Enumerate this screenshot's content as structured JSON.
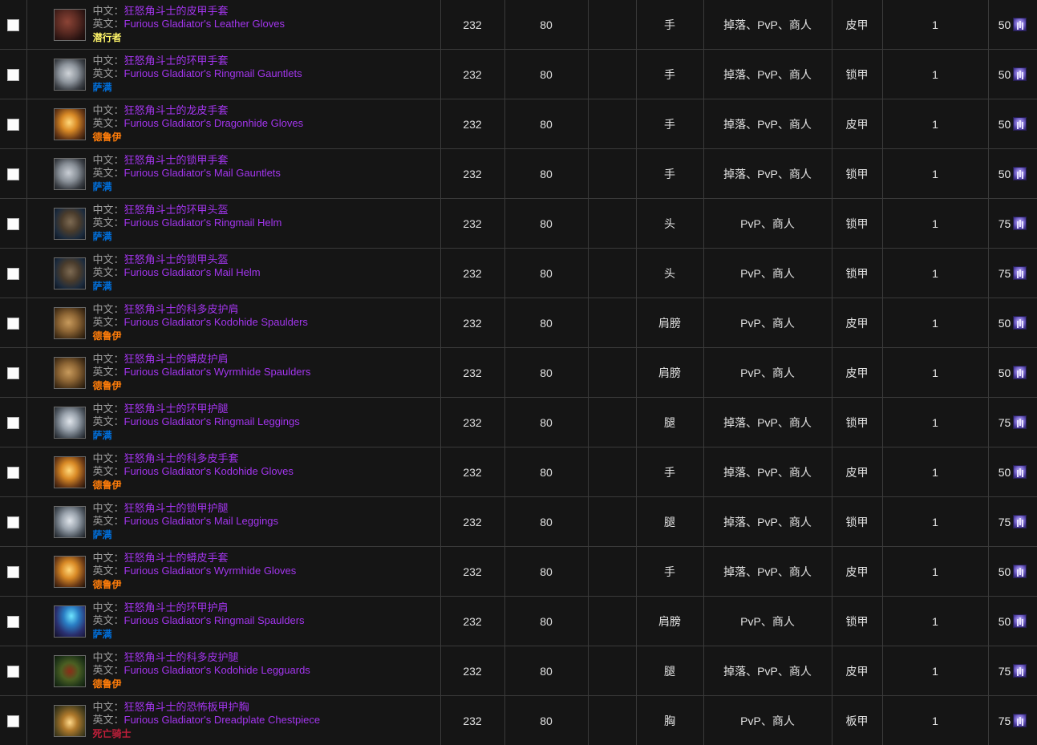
{
  "labels": {
    "zh_prefix": "中文：",
    "en_prefix": "英文：",
    "checkbox_name": "row-select-checkbox",
    "currency_icon": "arena-point-icon"
  },
  "classes": {
    "rogue": {
      "label": "潜行者",
      "color": "#fff569"
    },
    "shaman": {
      "label": "萨满",
      "color": "#0070dd"
    },
    "druid": {
      "label": "德鲁伊",
      "color": "#ff7d0a"
    },
    "deathknight": {
      "label": "死亡骑士",
      "color": "#c41f3b"
    }
  },
  "rows": [
    {
      "icon": "leather-gloves-red-icon",
      "zh": "狂怒角斗士的皮甲手套",
      "en": "Furious Gladiator's Leather Gloves",
      "cls": "潜行者",
      "cls_key": "rogue",
      "ilvl": "232",
      "req_level": "80",
      "extra": "",
      "slot": "手",
      "source": "掉落、PvP、商人",
      "armor": "皮甲",
      "qty": "1",
      "cost": "50"
    },
    {
      "icon": "ringmail-gauntlets-icon",
      "zh": "狂怒角斗士的环甲手套",
      "en": "Furious Gladiator's Ringmail Gauntlets",
      "cls": "萨满",
      "cls_key": "shaman",
      "ilvl": "232",
      "req_level": "80",
      "extra": "",
      "slot": "手",
      "source": "掉落、PvP、商人",
      "armor": "锁甲",
      "qty": "1",
      "cost": "50"
    },
    {
      "icon": "dragonhide-gloves-icon",
      "zh": "狂怒角斗士的龙皮手套",
      "en": "Furious Gladiator's Dragonhide Gloves",
      "cls": "德鲁伊",
      "cls_key": "druid",
      "ilvl": "232",
      "req_level": "80",
      "extra": "",
      "slot": "手",
      "source": "掉落、PvP、商人",
      "armor": "皮甲",
      "qty": "1",
      "cost": "50"
    },
    {
      "icon": "mail-gauntlets-icon",
      "zh": "狂怒角斗士的锁甲手套",
      "en": "Furious Gladiator's Mail Gauntlets",
      "cls": "萨满",
      "cls_key": "shaman",
      "ilvl": "232",
      "req_level": "80",
      "extra": "",
      "slot": "手",
      "source": "掉落、PvP、商人",
      "armor": "锁甲",
      "qty": "1",
      "cost": "50"
    },
    {
      "icon": "ringmail-helm-icon",
      "zh": "狂怒角斗士的环甲头盔",
      "en": "Furious Gladiator's Ringmail Helm",
      "cls": "萨满",
      "cls_key": "shaman",
      "ilvl": "232",
      "req_level": "80",
      "extra": "",
      "slot": "头",
      "source": "PvP、商人",
      "armor": "锁甲",
      "qty": "1",
      "cost": "75"
    },
    {
      "icon": "mail-helm-icon",
      "zh": "狂怒角斗士的锁甲头盔",
      "en": "Furious Gladiator's Mail Helm",
      "cls": "萨满",
      "cls_key": "shaman",
      "ilvl": "232",
      "req_level": "80",
      "extra": "",
      "slot": "头",
      "source": "PvP、商人",
      "armor": "锁甲",
      "qty": "1",
      "cost": "75"
    },
    {
      "icon": "kodohide-spaulders-icon",
      "zh": "狂怒角斗士的科多皮护肩",
      "en": "Furious Gladiator's Kodohide Spaulders",
      "cls": "德鲁伊",
      "cls_key": "druid",
      "ilvl": "232",
      "req_level": "80",
      "extra": "",
      "slot": "肩膀",
      "source": "PvP、商人",
      "armor": "皮甲",
      "qty": "1",
      "cost": "50"
    },
    {
      "icon": "wyrmhide-spaulders-icon",
      "zh": "狂怒角斗士的蟒皮护肩",
      "en": "Furious Gladiator's Wyrmhide Spaulders",
      "cls": "德鲁伊",
      "cls_key": "druid",
      "ilvl": "232",
      "req_level": "80",
      "extra": "",
      "slot": "肩膀",
      "source": "PvP、商人",
      "armor": "皮甲",
      "qty": "1",
      "cost": "50"
    },
    {
      "icon": "ringmail-leggings-icon",
      "zh": "狂怒角斗士的环甲护腿",
      "en": "Furious Gladiator's Ringmail Leggings",
      "cls": "萨满",
      "cls_key": "shaman",
      "ilvl": "232",
      "req_level": "80",
      "extra": "",
      "slot": "腿",
      "source": "掉落、PvP、商人",
      "armor": "锁甲",
      "qty": "1",
      "cost": "75"
    },
    {
      "icon": "kodohide-gloves-icon",
      "zh": "狂怒角斗士的科多皮手套",
      "en": "Furious Gladiator's Kodohide Gloves",
      "cls": "德鲁伊",
      "cls_key": "druid",
      "ilvl": "232",
      "req_level": "80",
      "extra": "",
      "slot": "手",
      "source": "掉落、PvP、商人",
      "armor": "皮甲",
      "qty": "1",
      "cost": "50"
    },
    {
      "icon": "mail-leggings-icon",
      "zh": "狂怒角斗士的锁甲护腿",
      "en": "Furious Gladiator's Mail Leggings",
      "cls": "萨满",
      "cls_key": "shaman",
      "ilvl": "232",
      "req_level": "80",
      "extra": "",
      "slot": "腿",
      "source": "掉落、PvP、商人",
      "armor": "锁甲",
      "qty": "1",
      "cost": "75"
    },
    {
      "icon": "wyrmhide-gloves-icon",
      "zh": "狂怒角斗士的蟒皮手套",
      "en": "Furious Gladiator's Wyrmhide Gloves",
      "cls": "德鲁伊",
      "cls_key": "druid",
      "ilvl": "232",
      "req_level": "80",
      "extra": "",
      "slot": "手",
      "source": "掉落、PvP、商人",
      "armor": "皮甲",
      "qty": "1",
      "cost": "50"
    },
    {
      "icon": "ringmail-spaulders-icon",
      "zh": "狂怒角斗士的环甲护肩",
      "en": "Furious Gladiator's Ringmail Spaulders",
      "cls": "萨满",
      "cls_key": "shaman",
      "ilvl": "232",
      "req_level": "80",
      "extra": "",
      "slot": "肩膀",
      "source": "PvP、商人",
      "armor": "锁甲",
      "qty": "1",
      "cost": "50"
    },
    {
      "icon": "kodohide-legguards-icon",
      "zh": "狂怒角斗士的科多皮护腿",
      "en": "Furious Gladiator's Kodohide Legguards",
      "cls": "德鲁伊",
      "cls_key": "druid",
      "ilvl": "232",
      "req_level": "80",
      "extra": "",
      "slot": "腿",
      "source": "掉落、PvP、商人",
      "armor": "皮甲",
      "qty": "1",
      "cost": "75"
    },
    {
      "icon": "dreadplate-chestpiece-icon",
      "zh": "狂怒角斗士的恐怖板甲护胸",
      "en": "Furious Gladiator's Dreadplate Chestpiece",
      "cls": "死亡骑士",
      "cls_key": "deathknight",
      "ilvl": "232",
      "req_level": "80",
      "extra": "",
      "slot": "胸",
      "source": "PvP、商人",
      "armor": "板甲",
      "qty": "1",
      "cost": "75"
    }
  ]
}
